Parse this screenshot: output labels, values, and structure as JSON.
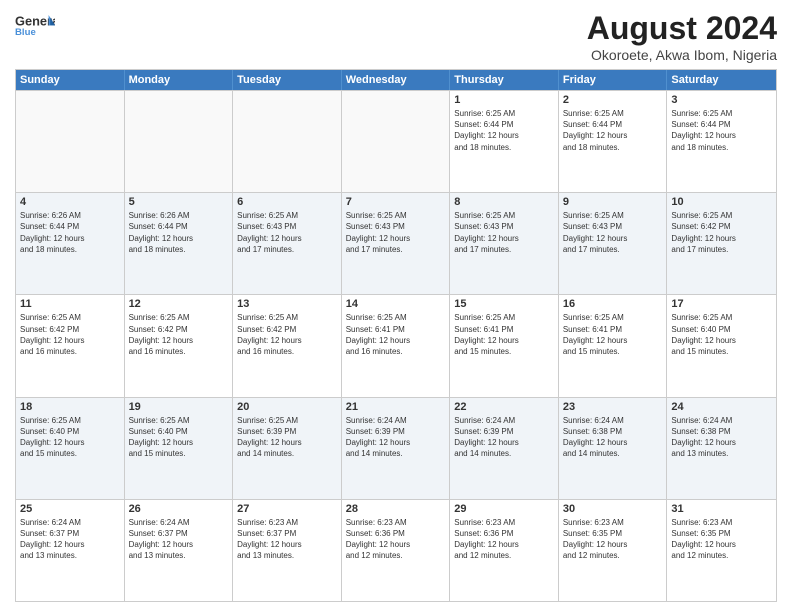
{
  "logo": {
    "line1": "General",
    "line2": "Blue"
  },
  "title": "August 2024",
  "subtitle": "Okoroete, Akwa Ibom, Nigeria",
  "days": [
    "Sunday",
    "Monday",
    "Tuesday",
    "Wednesday",
    "Thursday",
    "Friday",
    "Saturday"
  ],
  "weeks": [
    [
      {
        "day": "",
        "info": ""
      },
      {
        "day": "",
        "info": ""
      },
      {
        "day": "",
        "info": ""
      },
      {
        "day": "",
        "info": ""
      },
      {
        "day": "1",
        "info": "Sunrise: 6:25 AM\nSunset: 6:44 PM\nDaylight: 12 hours\nand 18 minutes."
      },
      {
        "day": "2",
        "info": "Sunrise: 6:25 AM\nSunset: 6:44 PM\nDaylight: 12 hours\nand 18 minutes."
      },
      {
        "day": "3",
        "info": "Sunrise: 6:25 AM\nSunset: 6:44 PM\nDaylight: 12 hours\nand 18 minutes."
      }
    ],
    [
      {
        "day": "4",
        "info": "Sunrise: 6:26 AM\nSunset: 6:44 PM\nDaylight: 12 hours\nand 18 minutes."
      },
      {
        "day": "5",
        "info": "Sunrise: 6:26 AM\nSunset: 6:44 PM\nDaylight: 12 hours\nand 18 minutes."
      },
      {
        "day": "6",
        "info": "Sunrise: 6:25 AM\nSunset: 6:43 PM\nDaylight: 12 hours\nand 17 minutes."
      },
      {
        "day": "7",
        "info": "Sunrise: 6:25 AM\nSunset: 6:43 PM\nDaylight: 12 hours\nand 17 minutes."
      },
      {
        "day": "8",
        "info": "Sunrise: 6:25 AM\nSunset: 6:43 PM\nDaylight: 12 hours\nand 17 minutes."
      },
      {
        "day": "9",
        "info": "Sunrise: 6:25 AM\nSunset: 6:43 PM\nDaylight: 12 hours\nand 17 minutes."
      },
      {
        "day": "10",
        "info": "Sunrise: 6:25 AM\nSunset: 6:42 PM\nDaylight: 12 hours\nand 17 minutes."
      }
    ],
    [
      {
        "day": "11",
        "info": "Sunrise: 6:25 AM\nSunset: 6:42 PM\nDaylight: 12 hours\nand 16 minutes."
      },
      {
        "day": "12",
        "info": "Sunrise: 6:25 AM\nSunset: 6:42 PM\nDaylight: 12 hours\nand 16 minutes."
      },
      {
        "day": "13",
        "info": "Sunrise: 6:25 AM\nSunset: 6:42 PM\nDaylight: 12 hours\nand 16 minutes."
      },
      {
        "day": "14",
        "info": "Sunrise: 6:25 AM\nSunset: 6:41 PM\nDaylight: 12 hours\nand 16 minutes."
      },
      {
        "day": "15",
        "info": "Sunrise: 6:25 AM\nSunset: 6:41 PM\nDaylight: 12 hours\nand 15 minutes."
      },
      {
        "day": "16",
        "info": "Sunrise: 6:25 AM\nSunset: 6:41 PM\nDaylight: 12 hours\nand 15 minutes."
      },
      {
        "day": "17",
        "info": "Sunrise: 6:25 AM\nSunset: 6:40 PM\nDaylight: 12 hours\nand 15 minutes."
      }
    ],
    [
      {
        "day": "18",
        "info": "Sunrise: 6:25 AM\nSunset: 6:40 PM\nDaylight: 12 hours\nand 15 minutes."
      },
      {
        "day": "19",
        "info": "Sunrise: 6:25 AM\nSunset: 6:40 PM\nDaylight: 12 hours\nand 15 minutes."
      },
      {
        "day": "20",
        "info": "Sunrise: 6:25 AM\nSunset: 6:39 PM\nDaylight: 12 hours\nand 14 minutes."
      },
      {
        "day": "21",
        "info": "Sunrise: 6:24 AM\nSunset: 6:39 PM\nDaylight: 12 hours\nand 14 minutes."
      },
      {
        "day": "22",
        "info": "Sunrise: 6:24 AM\nSunset: 6:39 PM\nDaylight: 12 hours\nand 14 minutes."
      },
      {
        "day": "23",
        "info": "Sunrise: 6:24 AM\nSunset: 6:38 PM\nDaylight: 12 hours\nand 14 minutes."
      },
      {
        "day": "24",
        "info": "Sunrise: 6:24 AM\nSunset: 6:38 PM\nDaylight: 12 hours\nand 13 minutes."
      }
    ],
    [
      {
        "day": "25",
        "info": "Sunrise: 6:24 AM\nSunset: 6:37 PM\nDaylight: 12 hours\nand 13 minutes."
      },
      {
        "day": "26",
        "info": "Sunrise: 6:24 AM\nSunset: 6:37 PM\nDaylight: 12 hours\nand 13 minutes."
      },
      {
        "day": "27",
        "info": "Sunrise: 6:23 AM\nSunset: 6:37 PM\nDaylight: 12 hours\nand 13 minutes."
      },
      {
        "day": "28",
        "info": "Sunrise: 6:23 AM\nSunset: 6:36 PM\nDaylight: 12 hours\nand 12 minutes."
      },
      {
        "day": "29",
        "info": "Sunrise: 6:23 AM\nSunset: 6:36 PM\nDaylight: 12 hours\nand 12 minutes."
      },
      {
        "day": "30",
        "info": "Sunrise: 6:23 AM\nSunset: 6:35 PM\nDaylight: 12 hours\nand 12 minutes."
      },
      {
        "day": "31",
        "info": "Sunrise: 6:23 AM\nSunset: 6:35 PM\nDaylight: 12 hours\nand 12 minutes."
      }
    ]
  ]
}
